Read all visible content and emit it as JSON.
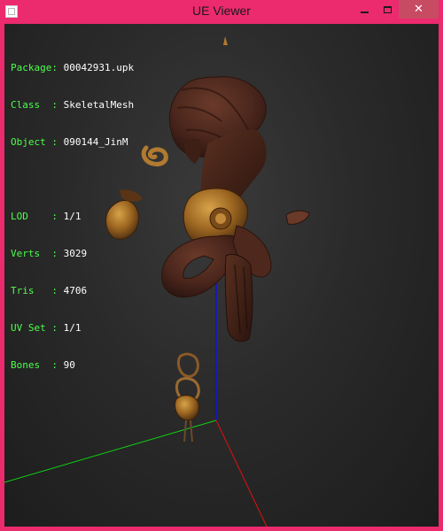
{
  "window": {
    "title": "UE Viewer",
    "controls": {
      "minimize": "minimize",
      "maximize": "maximize",
      "close": "close"
    }
  },
  "info": {
    "package_key": "Package: ",
    "package_value": "00042931.upk",
    "class_key": "Class  : ",
    "class_value": "SkeletalMesh",
    "object_key": "Object : ",
    "object_value": "090144_JinM",
    "lod_key": "LOD    : ",
    "lod_value": "1/1",
    "verts_key": "Verts  : ",
    "verts_value": "3029",
    "tris_key": "Tris   : ",
    "tris_value": "4706",
    "uvset_key": "UV Set : ",
    "uvset_value": "1/1",
    "bones_key": "Bones  : ",
    "bones_value": "90"
  },
  "colors": {
    "frame": "#ec2a6e",
    "close_button": "#c74b62",
    "info_key": "#4cff4c",
    "info_value": "#ffffff",
    "axis_x": "#e01010",
    "axis_y": "#10d010",
    "axis_z": "#1010e0"
  },
  "icons": {
    "app": "window-app-icon",
    "minimize": "minimize-icon",
    "maximize": "maximize-icon",
    "close": "close-icon"
  }
}
